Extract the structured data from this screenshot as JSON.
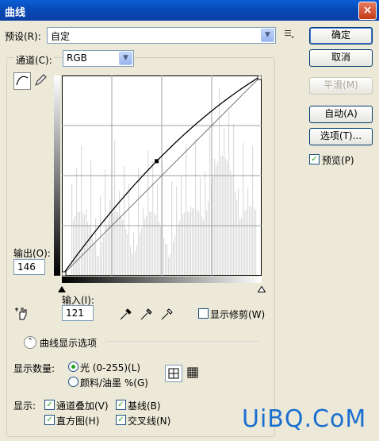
{
  "window": {
    "title": "曲线",
    "close": "×"
  },
  "preset": {
    "label": "预设(R):",
    "value": "自定",
    "menu_icon": "list-menu-icon"
  },
  "channel": {
    "label": "通道(C):",
    "value": "RGB"
  },
  "buttons": {
    "ok": "确定",
    "cancel": "取消",
    "smooth": "平滑(M)",
    "auto": "自动(A)",
    "options": "选项(T)..."
  },
  "preview": {
    "label": "预览(P)",
    "checked": true
  },
  "output": {
    "label": "输出(O):",
    "value": "146"
  },
  "input": {
    "label": "输入(I):",
    "value": "121"
  },
  "show_clipping": {
    "label": "显示修剪(W)",
    "checked": false
  },
  "display_options": {
    "label": "曲线显示选项"
  },
  "show_amount": {
    "label": "显示数量:",
    "light": "光 (0-255)(L)",
    "pigment": "颜料/油墨 %(G)",
    "selected": "light"
  },
  "show": {
    "label": "显示:",
    "channel_overlays": "通道叠加(V)",
    "baseline": "基线(B)",
    "histogram": "直方图(H)",
    "intersection": "交叉线(N)"
  },
  "watermark": "UiBQ.CoM",
  "curve": {
    "control_point": {
      "input": 121,
      "output": 146
    },
    "points": [
      [
        0,
        0
      ],
      [
        121,
        146
      ],
      [
        255,
        255
      ]
    ]
  },
  "colors": {
    "titlebar": "#0a4fc0",
    "dialog_bg": "#ece9d8",
    "check": "#21a121"
  }
}
